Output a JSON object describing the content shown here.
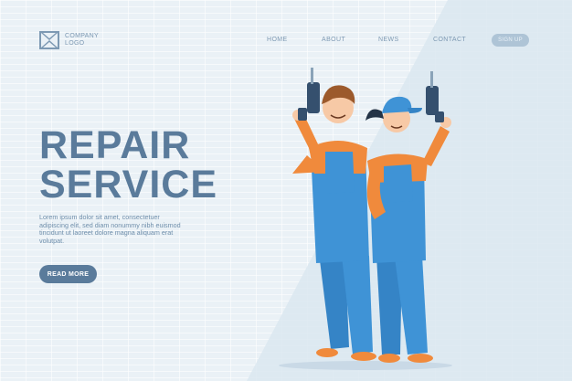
{
  "header": {
    "logo_line1": "COMPANY",
    "logo_line2": "LOGO",
    "nav": [
      {
        "label": "HOME"
      },
      {
        "label": "ABOUT"
      },
      {
        "label": "NEWS"
      },
      {
        "label": "CONTACT"
      }
    ],
    "signup_label": "SIGN UP"
  },
  "hero": {
    "title_line1": "REPAIR",
    "title_line2": "SERVICE",
    "body": "Lorem ipsum dolor sit amet, consectetuer adipiscing elit, sed diam nonummy nibh euismod tincidunt ut laoreet dolore magna aliquam erat volutpat.",
    "cta_label": "READ MORE"
  },
  "colors": {
    "background": "#eaf1f6",
    "accent": "#5a7b9b",
    "overall_blue": "#3f93d6",
    "shirt_orange": "#f08a3c"
  },
  "illustration": {
    "subject": "two repair workers holding drills",
    "icons": [
      "drill-icon",
      "cap-icon"
    ]
  }
}
